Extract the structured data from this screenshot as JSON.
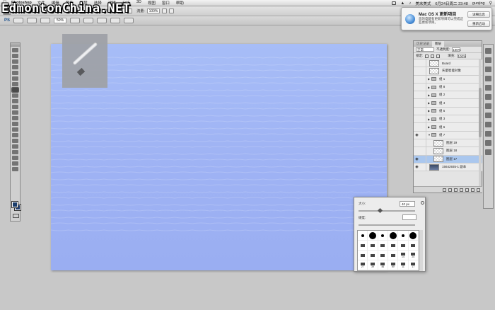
{
  "watermark": "EdmontonChina.NET",
  "menubar": {
    "app_name": "Photoshop",
    "items": [
      "文件",
      "编辑",
      "图像",
      "图层",
      "选择",
      "滤镜",
      "分析",
      "3D",
      "视图",
      "窗口",
      "帮助"
    ],
    "status_input": "美末美式",
    "clock": "6月24日周二  23:48",
    "user": "guojing"
  },
  "options_bar": {
    "opacity_label": "不透明度:",
    "opacity_value": "100%",
    "flow_label": "流量:",
    "flow_value": "100%"
  },
  "app_bar": {
    "logo": "PS",
    "zoom": "50%"
  },
  "notification": {
    "title": "Mac OS X 更新项目",
    "text": "您的电脑有更新项目可以完成这些更新项目。",
    "details_button": "详细信息",
    "later_button": "重新启动"
  },
  "layers_panel": {
    "tabs": [
      "历史记录",
      "图层"
    ],
    "blend_mode": "正常",
    "opacity_label": "不透明度:",
    "opacity_value": "100%",
    "lock_label": "锁定:",
    "fill_label": "填充:",
    "fill_value": "100%",
    "layers": [
      {
        "name": "Board",
        "type": "layer",
        "visible": false,
        "selected": false
      },
      {
        "name": "矢量智能对象",
        "type": "layer",
        "visible": false,
        "selected": false
      },
      {
        "name": "组 1",
        "type": "group",
        "visible": false,
        "selected": false
      },
      {
        "name": "组 8",
        "type": "group",
        "visible": false,
        "selected": false
      },
      {
        "name": "组 2",
        "type": "group",
        "visible": false,
        "selected": false
      },
      {
        "name": "组 4",
        "type": "group",
        "visible": false,
        "selected": false
      },
      {
        "name": "组 5",
        "type": "group",
        "visible": false,
        "selected": false
      },
      {
        "name": "组 3",
        "type": "group",
        "visible": false,
        "selected": false
      },
      {
        "name": "组 6",
        "type": "group",
        "visible": false,
        "selected": false
      },
      {
        "name": "组 7",
        "type": "group",
        "visible": true,
        "selected": false
      },
      {
        "name": "图层 19",
        "type": "child",
        "visible": false,
        "selected": false
      },
      {
        "name": "图层 18",
        "type": "child",
        "visible": false,
        "selected": false
      },
      {
        "name": "图层 17",
        "type": "child",
        "visible": true,
        "selected": true
      },
      {
        "name": "15642935-1 副本",
        "type": "photo",
        "visible": true,
        "selected": false
      }
    ]
  },
  "brush_popup": {
    "size_label": "大小:",
    "size_value": "40 px",
    "hardness_label": "硬度:",
    "brushes": [
      {
        "kind": "dot",
        "d": 4,
        "n": ""
      },
      {
        "kind": "dot",
        "d": 10,
        "n": ""
      },
      {
        "kind": "dot",
        "d": 4,
        "n": ""
      },
      {
        "kind": "dot",
        "d": 10,
        "n": ""
      },
      {
        "kind": "dot",
        "d": 4,
        "n": ""
      },
      {
        "kind": "dot",
        "d": 10,
        "n": ""
      },
      {
        "kind": "shape",
        "n": ""
      },
      {
        "kind": "shape",
        "n": ""
      },
      {
        "kind": "shape",
        "n": ""
      },
      {
        "kind": "shape",
        "n": ""
      },
      {
        "kind": "shape",
        "n": ""
      },
      {
        "kind": "shape",
        "n": ""
      },
      {
        "kind": "shape",
        "n": ""
      },
      {
        "kind": "shape",
        "n": ""
      },
      {
        "kind": "shape",
        "n": ""
      },
      {
        "kind": "shape",
        "n": ""
      },
      {
        "kind": "shape",
        "n": "14"
      },
      {
        "kind": "shape",
        "n": "24"
      },
      {
        "kind": "shape",
        "n": "27"
      },
      {
        "kind": "shape",
        "n": "39"
      },
      {
        "kind": "shape",
        "n": "46"
      },
      {
        "kind": "shape",
        "n": "59"
      },
      {
        "kind": "shape",
        "n": "11"
      },
      {
        "kind": "shape",
        "n": "17"
      }
    ]
  }
}
